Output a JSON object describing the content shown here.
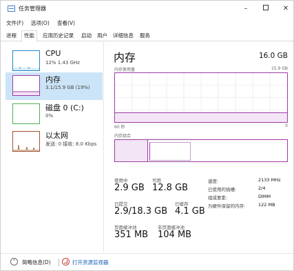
{
  "window": {
    "title": "任务管理器",
    "minimize": "–",
    "close": "✕"
  },
  "menu": [
    "文件(F)",
    "选项(O)",
    "查看(V)"
  ],
  "tabs": [
    "进程",
    "性能",
    "应用历史记录",
    "启动",
    "用户",
    "详细信息",
    "服务"
  ],
  "active_tab": "性能",
  "sidebar": {
    "items": [
      {
        "title": "CPU",
        "sub": "12% 1.43 GHz",
        "icon": "cpu-graph-icon",
        "color": "#1e88c8"
      },
      {
        "title": "内存",
        "sub": "3.1/15.9 GB (19%)",
        "icon": "memory-graph-icon",
        "color": "#9b3aa6"
      },
      {
        "title": "磁盘 0 (C:)",
        "sub": "0%",
        "icon": "disk-graph-icon",
        "color": "#4caf50"
      },
      {
        "title": "以太网",
        "sub": "发送: 0 接收: 8.0 Kbps",
        "icon": "ethernet-graph-icon",
        "color": "#a0522d"
      }
    ],
    "selected_index": 1
  },
  "memory": {
    "title": "内存",
    "total": "16.0 GB",
    "usage_label": "内存使用量",
    "usage_max": "15.9 GB",
    "axis_left": "60 秒",
    "axis_right": "0",
    "composition_label": "内存组合",
    "usage_level": 0.19,
    "composition": {
      "in_use": 0.19,
      "modified": 0.01,
      "standby": 0.24
    },
    "stats": {
      "in_use_label": "使用中",
      "in_use": "2.9 GB",
      "available_label": "可用",
      "available": "12.8 GB",
      "committed_label": "已提交",
      "committed": "2.9/18.3 GB",
      "cached_label": "已缓存",
      "cached": "4.1 GB",
      "paged_label": "页面缓冲池",
      "paged": "351 MB",
      "nonpaged_label": "非页面缓冲池",
      "nonpaged": "104 MB"
    },
    "details": [
      {
        "label": "速度:",
        "value": "2133 MHz"
      },
      {
        "label": "已使用的插槽:",
        "value": "2/4"
      },
      {
        "label": "组成要素:",
        "value": "DIMM"
      },
      {
        "label": "为硬件保留的内存:",
        "value": "122 MB"
      }
    ],
    "color": "#9b3aa6"
  },
  "footer": {
    "fewer_details": "简略信息(D)",
    "open_monitor": "打开资源监视器"
  }
}
